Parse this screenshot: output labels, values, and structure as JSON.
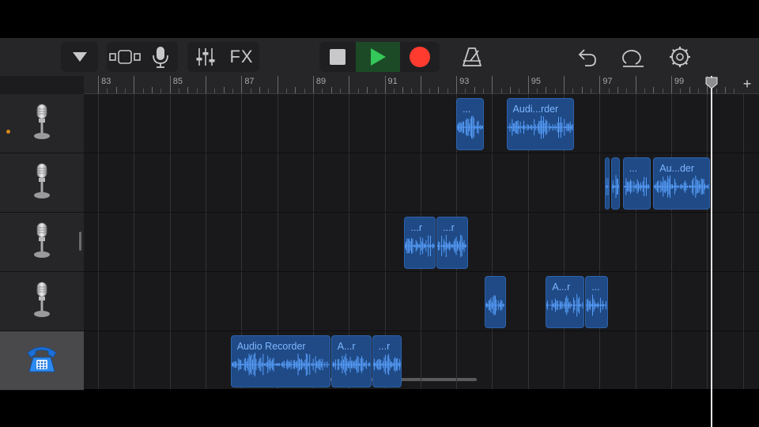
{
  "toolbar": {
    "fx_label": "FX",
    "icons": [
      "dropdown-icon",
      "view-toggle-icon",
      "microphone-icon",
      "mixer-icon",
      "fx-button",
      "stop-icon",
      "play-icon",
      "record-icon",
      "metronome-icon",
      "undo-icon",
      "loop-icon",
      "settings-icon"
    ],
    "colors": {
      "play": "#34c759",
      "record": "#ff3b30"
    }
  },
  "ruler": {
    "bars": [
      "83",
      "85",
      "87",
      "89",
      "91",
      "93",
      "95",
      "97",
      "99"
    ],
    "add_label": "+"
  },
  "tracks": [
    {
      "instrument": "microphone",
      "icon": "microphone-icon",
      "record_armed": true,
      "regions": [
        {
          "label": "...",
          "start": 93.0,
          "end": 93.8
        },
        {
          "label": "Audi...rder",
          "start": 94.4,
          "end": 96.3
        }
      ]
    },
    {
      "instrument": "microphone",
      "icon": "microphone-icon",
      "record_armed": false,
      "regions": [
        {
          "label": "",
          "start": 97.15,
          "end": 97.28
        },
        {
          "label": "",
          "start": 97.33,
          "end": 97.6
        },
        {
          "label": "...",
          "start": 97.65,
          "end": 98.45
        },
        {
          "label": "Au...der",
          "start": 98.5,
          "end": 100.1
        }
      ]
    },
    {
      "instrument": "microphone",
      "icon": "microphone-icon",
      "record_armed": false,
      "regions": [
        {
          "label": "...r",
          "start": 91.55,
          "end": 92.45
        },
        {
          "label": "...r",
          "start": 92.45,
          "end": 93.35
        }
      ]
    },
    {
      "instrument": "microphone",
      "icon": "microphone-icon",
      "record_armed": false,
      "regions": [
        {
          "label": "",
          "start": 93.8,
          "end": 94.4
        },
        {
          "label": "A...r",
          "start": 95.5,
          "end": 96.6
        },
        {
          "label": "...",
          "start": 96.6,
          "end": 97.25
        }
      ]
    },
    {
      "instrument": "telephone",
      "icon": "telephone-icon",
      "record_armed": false,
      "selected": true,
      "regions": [
        {
          "label": "Audio Recorder",
          "start": 86.7,
          "end": 89.5
        },
        {
          "label": "A...r",
          "start": 89.5,
          "end": 90.65
        },
        {
          "label": "...r",
          "start": 90.65,
          "end": 91.5
        }
      ]
    }
  ],
  "timeline": {
    "start_bar": 82.6,
    "playhead_bar": 100.1
  },
  "colors": {
    "region": "#1f4a86",
    "region_text": "#7fb6ff",
    "waveform": "#5aa2ff"
  }
}
